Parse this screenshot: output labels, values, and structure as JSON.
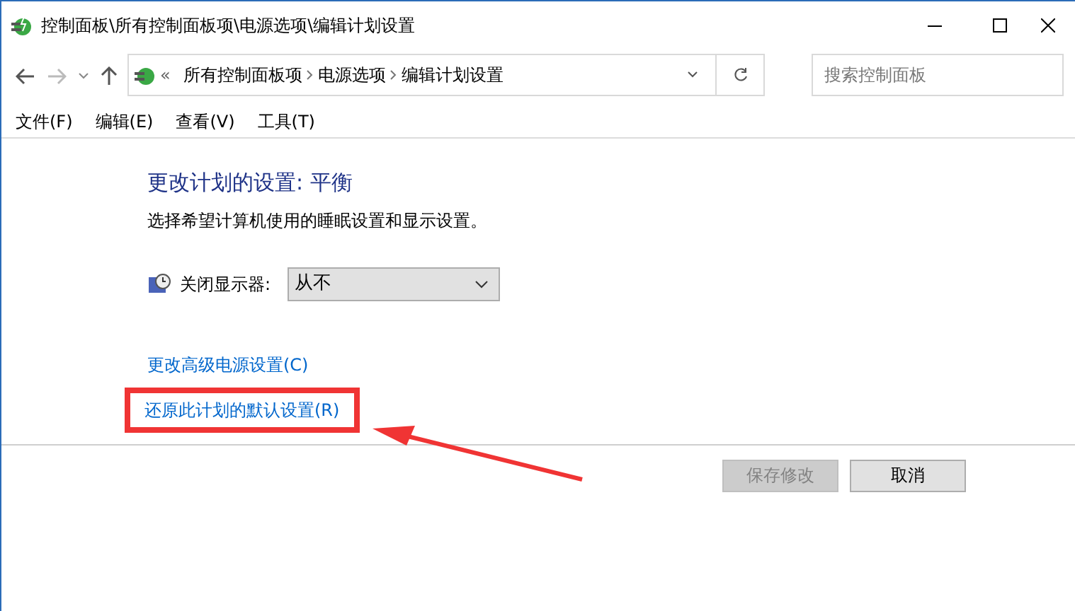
{
  "window": {
    "title": "控制面板\\所有控制面板项\\电源选项\\编辑计划设置"
  },
  "address_bar": {
    "prefix": "«",
    "crumbs": [
      "所有控制面板项",
      "电源选项",
      "编辑计划设置"
    ]
  },
  "search": {
    "placeholder": "搜索控制面板"
  },
  "menu": [
    "文件(F)",
    "编辑(E)",
    "查看(V)",
    "工具(T)"
  ],
  "heading": "更改计划的设置: 平衡",
  "subtitle": "选择希望计算机使用的睡眠设置和显示设置。",
  "settings": [
    {
      "label": "关闭显示器:",
      "value": "从不"
    }
  ],
  "links": [
    {
      "text": "更改高级电源设置(C)",
      "highlighted": false
    },
    {
      "text": "还原此计划的默认设置(R)",
      "highlighted": true
    }
  ],
  "buttons": [
    {
      "label": "保存修改",
      "disabled": true
    },
    {
      "label": "取消",
      "disabled": false
    }
  ]
}
